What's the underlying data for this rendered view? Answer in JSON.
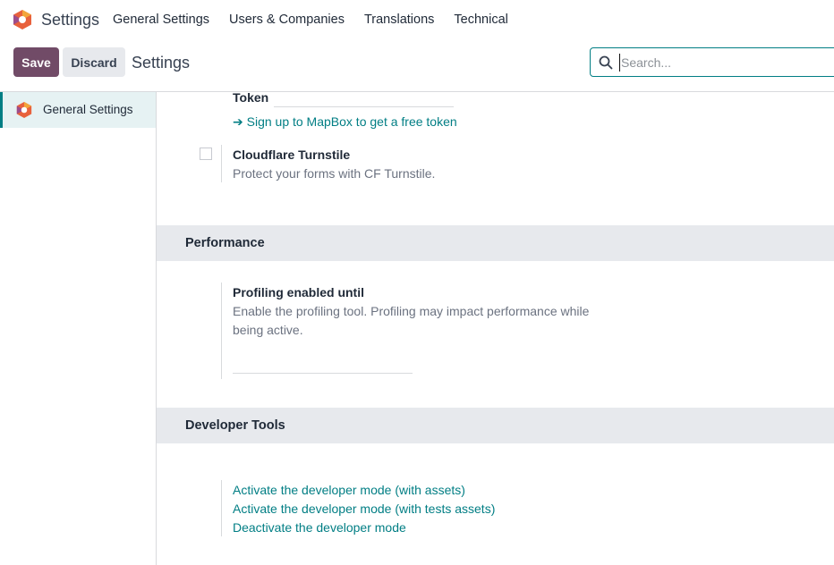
{
  "navbar": {
    "app_title": "Settings",
    "menu": [
      "General Settings",
      "Users & Companies",
      "Translations",
      "Technical"
    ]
  },
  "control_panel": {
    "save_label": "Save",
    "discard_label": "Discard",
    "title": "Settings",
    "search_placeholder": "Search..."
  },
  "sidebar": {
    "items": [
      {
        "label": "General Settings",
        "icon": "odoo-logo-icon",
        "active": true
      }
    ]
  },
  "main": {
    "token_label": "Token",
    "mapbox_link": "➔ Sign up to MapBox to get a free token",
    "cloudflare": {
      "label": "Cloudflare Turnstile",
      "description": "Protect your forms with CF Turnstile.",
      "checked": false
    },
    "performance": {
      "header": "Performance",
      "label": "Profiling enabled until",
      "description_line1": "Enable the profiling tool. Profiling may impact performance while",
      "description_line2": "being active."
    },
    "developer_tools": {
      "header": "Developer Tools",
      "links": [
        "Activate the developer mode (with assets)",
        "Activate the developer mode (with tests assets)",
        "Deactivate the developer mode"
      ]
    }
  },
  "colors": {
    "brand": "#714b67",
    "accent": "#017e84",
    "section_bg": "#e7e9ed"
  }
}
